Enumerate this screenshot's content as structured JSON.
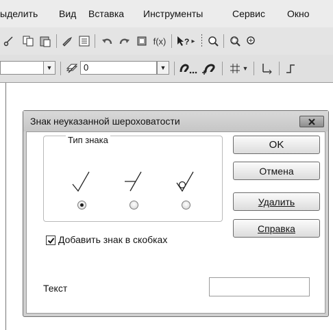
{
  "menu": {
    "items": [
      {
        "label": "ыделить"
      },
      {
        "label": "Вид"
      },
      {
        "label": "Вставка"
      },
      {
        "label": "Инструменты"
      },
      {
        "label": "Сервис"
      },
      {
        "label": "Окно"
      }
    ]
  },
  "toolbar": {
    "icons": [
      "copy-icon",
      "paste-icon",
      "properties-icon",
      "list-icon",
      "undo-icon",
      "redo-icon",
      "library-icon",
      "function-icon",
      "pointer-help-icon",
      "zoom-icon",
      "zoom-window-icon",
      "zoom-in-icon"
    ],
    "function_label": "f(x)",
    "layer_value": "0"
  },
  "dialog": {
    "title": "Знак неуказанной шероховатости",
    "group_label": "Тип знака",
    "symbols": [
      "roughness-basic-symbol",
      "roughness-machined-symbol",
      "roughness-unmachined-symbol"
    ],
    "selected_symbol": 0,
    "buttons": {
      "ok": "OK",
      "cancel": "Отмена",
      "delete": "Удалить",
      "help": "Справка"
    },
    "checkbox_label": "Добавить знак в скобках",
    "checkbox_checked": true,
    "text_label": "Текст",
    "text_value": ""
  }
}
